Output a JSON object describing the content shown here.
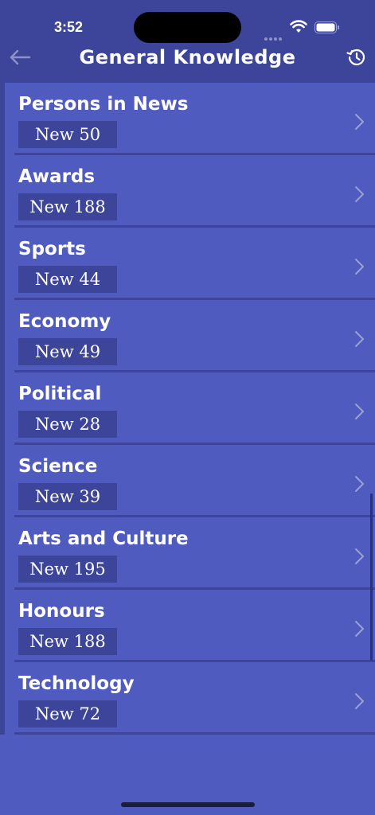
{
  "status": {
    "time": "3:52"
  },
  "nav": {
    "title": "General Knowledge"
  },
  "items": [
    {
      "category": "Persons in News",
      "badge": "New 50"
    },
    {
      "category": "Awards",
      "badge": "New 188"
    },
    {
      "category": "Sports",
      "badge": "New 44"
    },
    {
      "category": "Economy",
      "badge": "New 49"
    },
    {
      "category": "Political",
      "badge": "New 28"
    },
    {
      "category": "Science",
      "badge": "New 39"
    },
    {
      "category": "Arts and Culture",
      "badge": "New 195"
    },
    {
      "category": "Honours",
      "badge": "New 188"
    },
    {
      "category": "Technology",
      "badge": "New 72"
    }
  ],
  "colors": {
    "background": "#4f5bbe",
    "bar": "#3c4599",
    "text": "#ffffff"
  }
}
